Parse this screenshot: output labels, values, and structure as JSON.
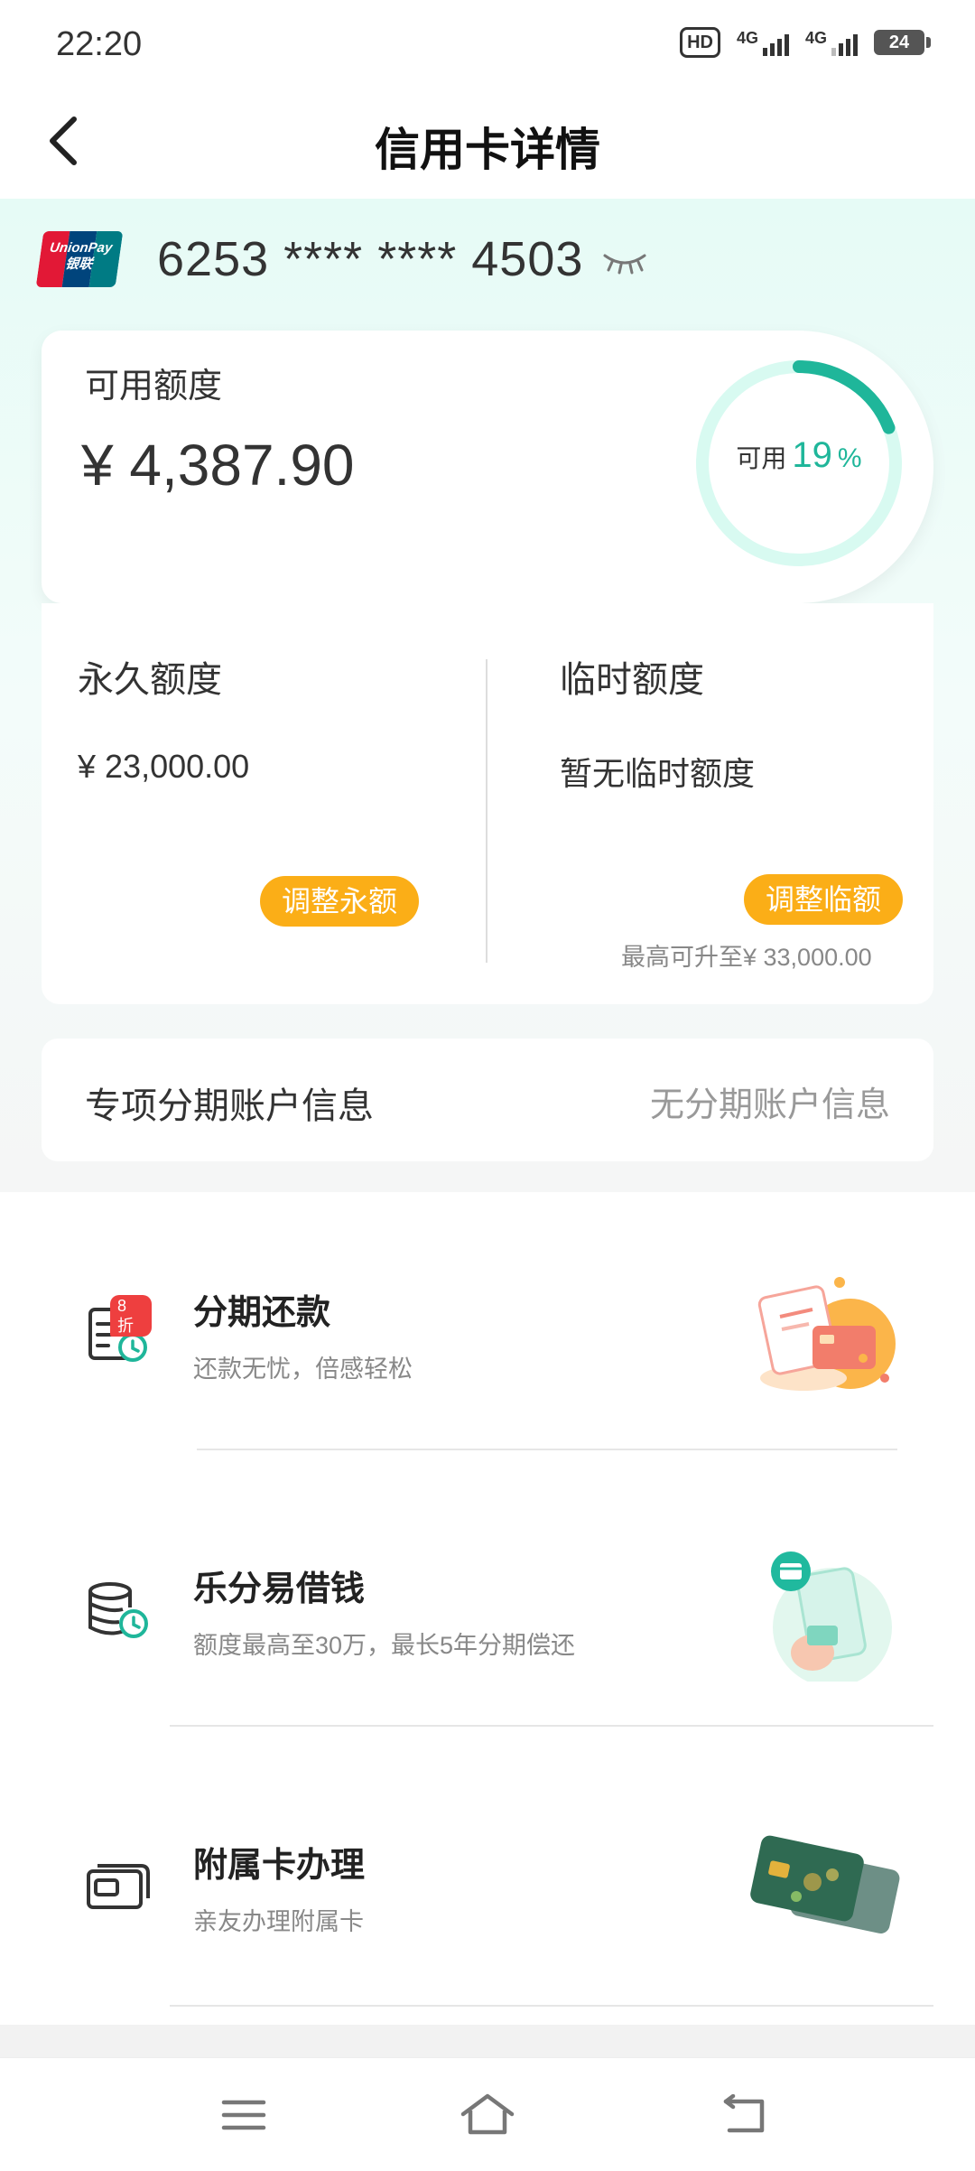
{
  "status_bar": {
    "time": "22:20",
    "hd_label": "HD",
    "network_1": "4G",
    "network_2": "4G",
    "battery": "24"
  },
  "header": {
    "title": "信用卡详情"
  },
  "card": {
    "brand_line1": "UnionPay",
    "brand_line2": "银联",
    "number": "6253 **** **** 4503"
  },
  "available": {
    "label": "可用额度",
    "amount": "¥ 4,387.90",
    "ring_label": "可用",
    "ring_percent": "19",
    "ring_unit": "%",
    "ratio": 0.19,
    "ring_color": "#1fb69a",
    "ring_track_color": "#d8faf1"
  },
  "limits": {
    "permanent_label": "永久额度",
    "permanent_value": "¥ 23,000.00",
    "permanent_button": "调整永额",
    "temporary_label": "临时额度",
    "temporary_value": "暂无临时额度",
    "temporary_button": "调整临额",
    "temporary_note": "最高可升至¥ 33,000.00"
  },
  "installment_account": {
    "label": "专项分期账户信息",
    "value": "无分期账户信息"
  },
  "services": [
    {
      "title": "分期还款",
      "subtitle": "还款无忧，倍感轻松",
      "badge": "8 折"
    },
    {
      "title": "乐分易借钱",
      "subtitle": "额度最高至30万，最长5年分期偿还"
    },
    {
      "title": "附属卡办理",
      "subtitle": "亲友办理附属卡"
    }
  ],
  "colors": {
    "accent": "#1fb69a",
    "button": "#fbae17"
  }
}
